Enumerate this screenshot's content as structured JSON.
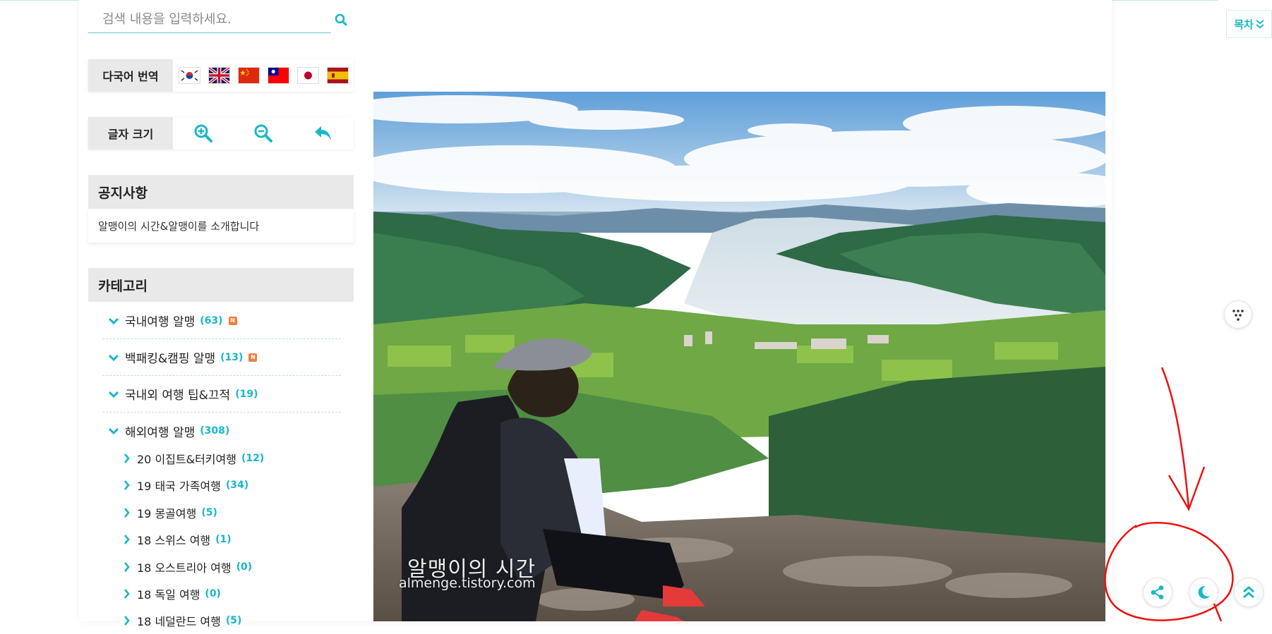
{
  "search": {
    "placeholder": "검색 내용을 입력하세요."
  },
  "translate": {
    "label": "다국어 번역",
    "flags": [
      "Korean",
      "English",
      "Chinese (Simplified)",
      "Chinese (Traditional)",
      "Japanese",
      "Spanish"
    ]
  },
  "font_size": {
    "label": "글자 크기"
  },
  "notice": {
    "title": "공지사항",
    "item": "알맹이의 시간&알맹이를 소개합니다"
  },
  "category": {
    "title": "카테고리",
    "items": [
      {
        "name": "국내여행 알맹",
        "count": "(63)",
        "badge": "N"
      },
      {
        "name": "백패킹&캠핑 알맹",
        "count": "(13)",
        "badge": "N"
      },
      {
        "name": "국내외 여행 팁&끄적",
        "count": "(19)"
      },
      {
        "name": "해외여행 알맹",
        "count": "(308)"
      }
    ],
    "sub_items": [
      {
        "name": "20 이집트&터키여행",
        "count": "(12)"
      },
      {
        "name": "19 태국 가족여행",
        "count": "(34)"
      },
      {
        "name": "19 몽골여행",
        "count": "(5)"
      },
      {
        "name": "18 스위스 여행",
        "count": "(1)"
      },
      {
        "name": "18 오스트리아 여행",
        "count": "(0)"
      },
      {
        "name": "18 독일 여행",
        "count": "(0)"
      },
      {
        "name": "18 네덜란드 여행",
        "count": "(5)"
      }
    ]
  },
  "photo": {
    "watermark_title": "알맹이의 시간",
    "watermark_url": "almenge.tistory.com"
  },
  "toc": {
    "label": "목차"
  },
  "colors": {
    "accent": "#19b7c8",
    "annotation": "#ee1111",
    "label_bg": "#e9e9e9"
  }
}
